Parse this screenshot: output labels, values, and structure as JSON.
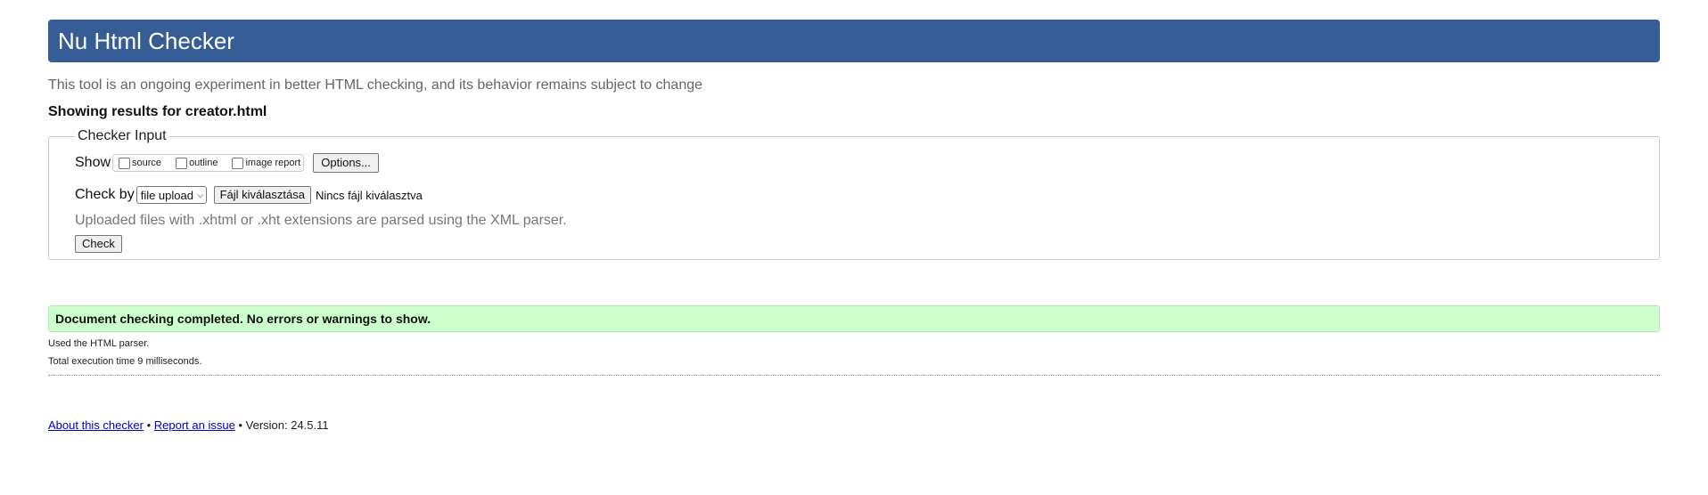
{
  "header": {
    "title": "Nu Html Checker"
  },
  "intro_text": "This tool is an ongoing experiment in better HTML checking, and its behavior remains subject to change",
  "results_heading": "Showing results for creator.html",
  "checker_input": {
    "legend": "Checker Input",
    "show_label": "Show",
    "show_options": [
      {
        "label": "source",
        "checked": false
      },
      {
        "label": "outline",
        "checked": false
      },
      {
        "label": "image report",
        "checked": false
      }
    ],
    "options_button": "Options...",
    "check_by_label": "Check by",
    "check_by_selected": "file upload",
    "file_button": "Fájl kiválasztása",
    "file_status": "Nincs fájl kiválasztva",
    "hint": "Uploaded files with .xhtml or .xht extensions are parsed using the XML parser.",
    "check_button": "Check"
  },
  "result": {
    "message": "Document checking completed. No errors or warnings to show.",
    "parser_info": "Used the HTML parser.",
    "execution_time": "Total execution time 9 milliseconds."
  },
  "footer": {
    "about_link": "About this checker",
    "separator": "•",
    "report_link": "Report an issue",
    "version": "Version: 24.5.11"
  },
  "colors": {
    "header_bg": "#365d95",
    "success_bg": "#ccffcc",
    "link": "#0000cc"
  }
}
